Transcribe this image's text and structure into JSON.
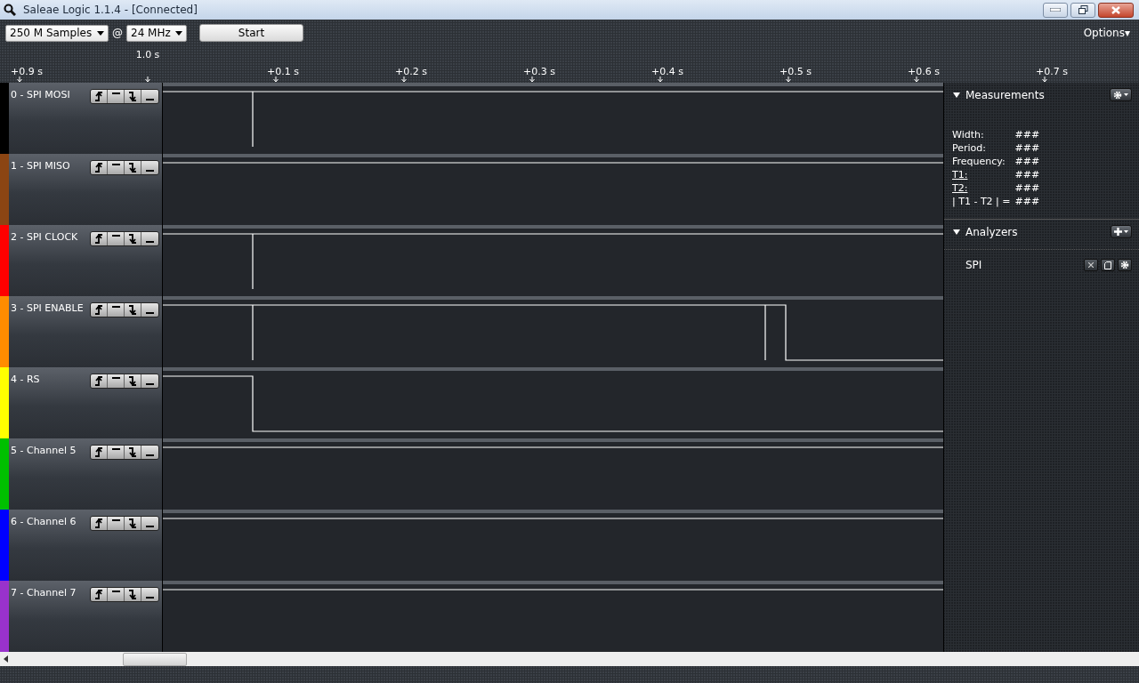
{
  "window": {
    "title": "Saleae Logic 1.1.4 - [Connected]"
  },
  "toolbar": {
    "samples": "250 M Samples",
    "at": "@",
    "rate": "24 MHz",
    "start": "Start",
    "options": "Options▾"
  },
  "ruler": {
    "absolute_time": "1.0 s",
    "ticks": [
      "+0.9 s",
      "+0.1 s",
      "+0.2 s",
      "+0.3 s",
      "+0.4 s",
      "+0.5 s",
      "+0.6 s",
      "+0.7 s"
    ]
  },
  "channels": [
    {
      "name": "0 - SPI MOSI",
      "color": "#000000",
      "kind": "glitch"
    },
    {
      "name": "1 - SPI MISO",
      "color": "#8b4513",
      "kind": "high"
    },
    {
      "name": "2 - SPI CLOCK",
      "color": "#ff0000",
      "kind": "glitch"
    },
    {
      "name": "3 - SPI ENABLE",
      "color": "#ff8c00",
      "kind": "glitchfall"
    },
    {
      "name": "4 - RS",
      "color": "#ffff00",
      "kind": "fall"
    },
    {
      "name": "5 - Channel 5",
      "color": "#00c000",
      "kind": "high"
    },
    {
      "name": "6 - Channel 6",
      "color": "#0000ff",
      "kind": "high"
    },
    {
      "name": "7 - Channel 7",
      "color": "#9932cc",
      "kind": "high"
    }
  ],
  "measurements": {
    "title": "Measurements",
    "rows": [
      {
        "label": "Width:",
        "value": "###",
        "underlined": false
      },
      {
        "label": "Period:",
        "value": "###",
        "underlined": false
      },
      {
        "label": "Frequency:",
        "value": "###",
        "underlined": false
      },
      {
        "label": "T1:",
        "value": "###",
        "underlined": true
      },
      {
        "label": "T2:",
        "value": "###",
        "underlined": true
      },
      {
        "label": "| T1 - T2 | =",
        "value": "###",
        "underlined": false
      }
    ]
  },
  "analyzers": {
    "title": "Analyzers",
    "items": [
      "SPI"
    ]
  }
}
